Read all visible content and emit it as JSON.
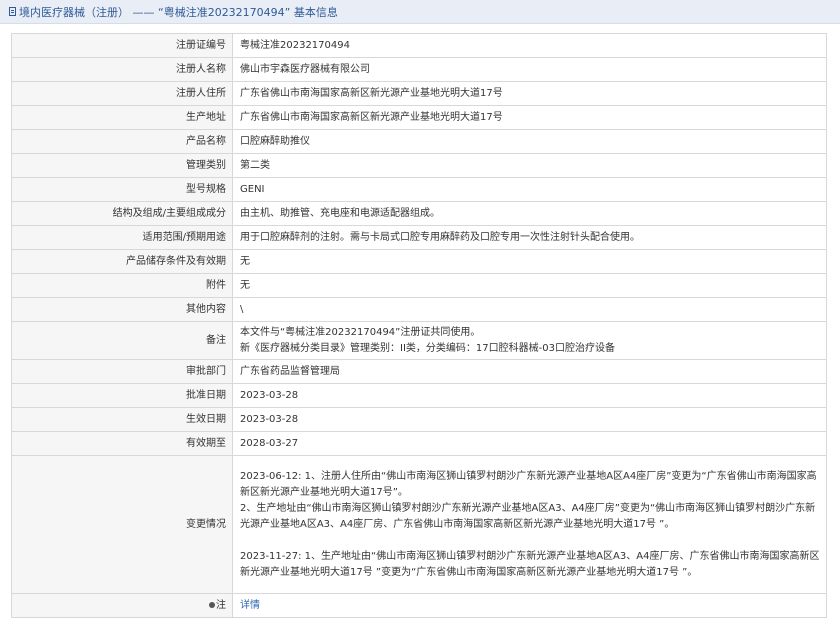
{
  "header": {
    "title": "境内医疗器械（注册） —— “粤械注准20232170494” 基本信息"
  },
  "rows": [
    {
      "label": "注册证编号",
      "value": "粤械注准20232170494"
    },
    {
      "label": "注册人名称",
      "value": "佛山市宇森医疗器械有限公司"
    },
    {
      "label": "注册人住所",
      "value": "广东省佛山市南海国家高新区新光源产业基地光明大道17号"
    },
    {
      "label": "生产地址",
      "value": "广东省佛山市南海国家高新区新光源产业基地光明大道17号"
    },
    {
      "label": "产品名称",
      "value": "口腔麻醉助推仪"
    },
    {
      "label": "管理类别",
      "value": "第二类"
    },
    {
      "label": "型号规格",
      "value": "GENI"
    },
    {
      "label": "结构及组成/主要组成成分",
      "value": "由主机、助推管、充电座和电源适配器组成。"
    },
    {
      "label": "适用范围/预期用途",
      "value": "用于口腔麻醉剂的注射。需与卡局式口腔专用麻醉药及口腔专用一次性注射针头配合使用。"
    },
    {
      "label": "产品储存条件及有效期",
      "value": "无"
    },
    {
      "label": "附件",
      "value": "无"
    },
    {
      "label": "其他内容",
      "value": "\\"
    }
  ],
  "remark": {
    "label": "备注",
    "line1": "本文件与“粤械注准20232170494”注册证共同使用。",
    "line2": "新《医疗器械分类目录》管理类别：II类，分类编码：17口腔科器械-03口腔治疗设备"
  },
  "rows2": [
    {
      "label": "审批部门",
      "value": "广东省药品监督管理局"
    },
    {
      "label": "批准日期",
      "value": "2023-03-28"
    },
    {
      "label": "生效日期",
      "value": "2023-03-28"
    },
    {
      "label": "有效期至",
      "value": "2028-03-27"
    }
  ],
  "changes": {
    "label": "变更情况",
    "p1": "2023-06-12: 1、注册人住所由“佛山市南海区狮山镇罗村朗沙广东新光源产业基地A区A4座厂房”变更为“广东省佛山市南海国家高新区新光源产业基地光明大道17号”。",
    "p2": "2、生产地址由“佛山市南海区狮山镇罗村朗沙广东新光源产业基地A区A3、A4座厂房”变更为“佛山市南海区狮山镇罗村朗沙广东新光源产业基地A区A3、A4座厂房、广东省佛山市南海国家高新区新光源产业基地光明大道17号 ”。",
    "p3": "2023-11-27: 1、生产地址由“佛山市南海区狮山镇罗村朗沙广东新光源产业基地A区A3、A4座厂房、广东省佛山市南海国家高新区新光源产业基地光明大道17号 ”变更为“广东省佛山市南海国家高新区新光源产业基地光明大道17号 ”。"
  },
  "note": {
    "label": "注",
    "link": "详情"
  }
}
